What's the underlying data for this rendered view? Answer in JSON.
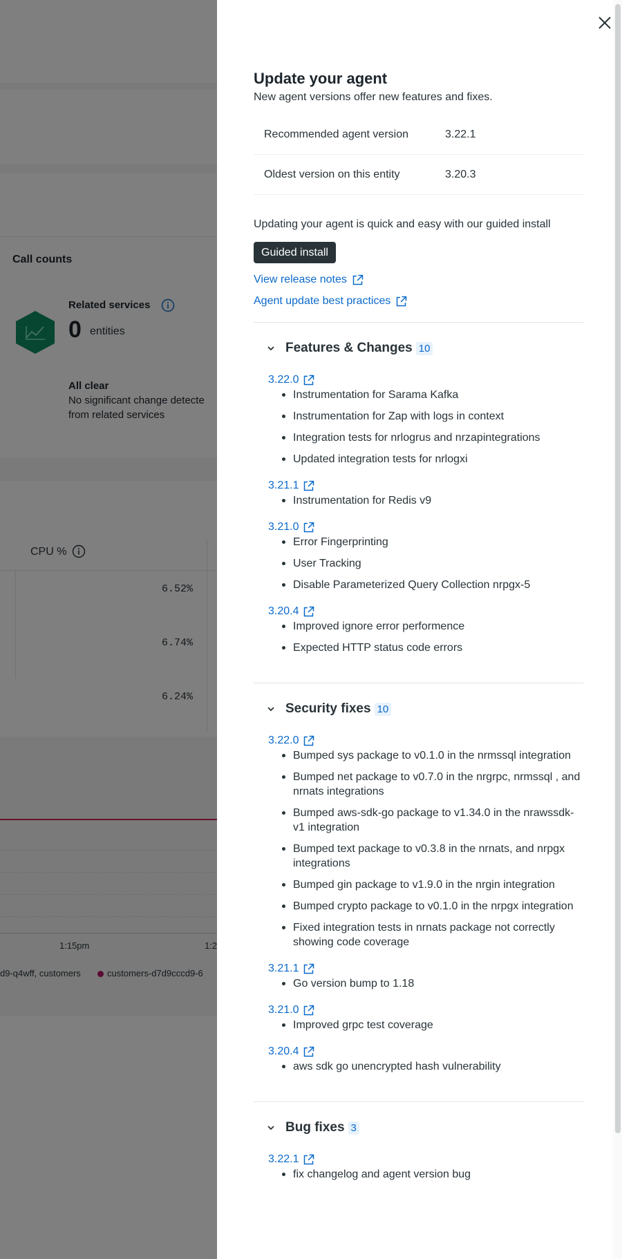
{
  "background": {
    "call_counts_title": "Call counts",
    "related_services_label": "Related services",
    "entities_count": "0",
    "entities_label": "entities",
    "all_clear_title": "All clear",
    "all_clear_line1": "No significant change detecte",
    "all_clear_line2": "from related services",
    "cpu_header": "CPU %",
    "cpu_values": [
      "6.52%",
      "6.74%",
      "6.24%"
    ],
    "time_labels": [
      "1:15pm",
      "1:2"
    ],
    "legend_items": [
      "d9-q4wff, customers",
      "customers-d7d9cccd9-6"
    ],
    "colors": {
      "hexagon": "#0e8c62",
      "line": "#c62a56",
      "legend_dot": "#b3166d"
    }
  },
  "drawer": {
    "title": "Update your agent",
    "subtitle": "New agent versions offer new features and fixes.",
    "versions": [
      {
        "label": "Recommended agent version",
        "value": "3.22.1"
      },
      {
        "label": "Oldest version on this entity",
        "value": "3.20.3"
      }
    ],
    "guide_text": "Updating your agent is quick and easy with our guided install",
    "guided_install_label": "Guided install",
    "release_notes_link": "View release notes",
    "best_practices_link": "Agent update best practices",
    "sections": [
      {
        "title": "Features & Changes",
        "count": "10",
        "releases": [
          {
            "version": "3.22.0",
            "items": [
              "Instrumentation for Sarama Kafka",
              "Instrumentation for Zap with logs in context",
              "Integration tests for nrlogrus and nrzapintegrations",
              "Updated integration tests for nrlogxi"
            ]
          },
          {
            "version": "3.21.1",
            "items": [
              "Instrumentation for Redis v9"
            ]
          },
          {
            "version": "3.21.0",
            "items": [
              "Error Fingerprinting",
              "User Tracking",
              "Disable Parameterized Query Collection nrpgx-5"
            ]
          },
          {
            "version": "3.20.4",
            "items": [
              "Improved ignore error performence",
              "Expected HTTP status code errors"
            ]
          }
        ]
      },
      {
        "title": "Security fixes",
        "count": "10",
        "releases": [
          {
            "version": "3.22.0",
            "items": [
              "Bumped sys package to v0.1.0 in the nrmssql integration",
              "Bumped net package to v0.7.0 in the nrgrpc, nrmssql , and nrnats integrations",
              "Bumped aws-sdk-go package to v1.34.0 in the nrawssdk-v1 integration",
              "Bumped text package to v0.3.8 in the nrnats, and nrpgx integrations",
              "Bumped gin package to v1.9.0 in the nrgin integration",
              "Bumped crypto package to v0.1.0 in the nrpgx integration",
              "Fixed integration tests in nrnats package not correctly showing code coverage"
            ]
          },
          {
            "version": "3.21.1",
            "items": [
              "Go version bump to 1.18"
            ]
          },
          {
            "version": "3.21.0",
            "items": [
              "Improved grpc test coverage"
            ]
          },
          {
            "version": "3.20.4",
            "items": [
              "aws sdk go unencrypted hash vulnerability"
            ]
          }
        ]
      },
      {
        "title": "Bug fixes",
        "count": "3",
        "releases": [
          {
            "version": "3.22.1",
            "items": [
              "fix changelog and agent version bug"
            ]
          }
        ]
      }
    ]
  }
}
